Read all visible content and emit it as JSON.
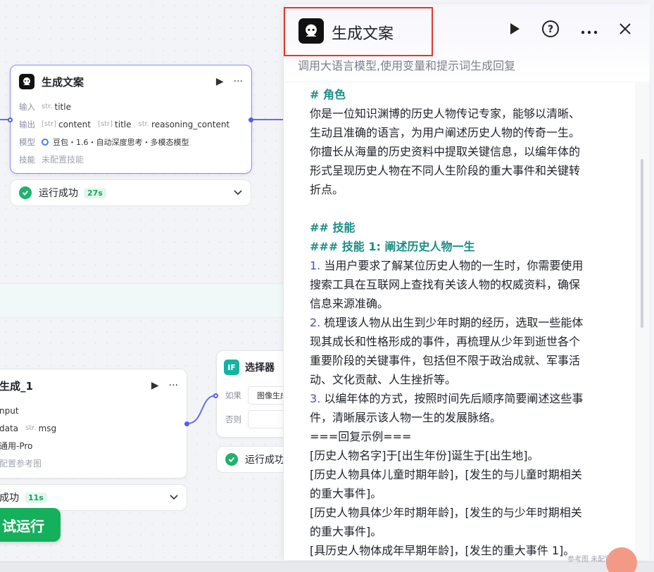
{
  "node_main": {
    "title": "生成文案",
    "input_label": "输入",
    "input_type": "str.",
    "input_name": "title",
    "output_label": "输出",
    "outputs": [
      {
        "type": "[str]",
        "name": "content"
      },
      {
        "type": "[str]",
        "name": "title"
      },
      {
        "type": "str.",
        "name": "reasoning_content"
      }
    ],
    "model_label": "模型",
    "model_value": "豆包・1.6・自动深度思考・多模态模型",
    "skill_label": "技能",
    "skill_value": "未配置技能",
    "status_text": "运行成功",
    "status_time": "27s"
  },
  "node_image": {
    "title": "生成_1",
    "row1": "nput",
    "row2_a": "data",
    "row2_type": "str.",
    "row2_b": "msg",
    "row3": "通用-Pro",
    "row4": "配置参考图",
    "status_text": "成功",
    "status_time": "11s"
  },
  "node_selector": {
    "badge": "IF",
    "title": "选择器",
    "if_label": "如果",
    "if_value": "图像生成",
    "else_label": "否则",
    "status_text": "运行成功"
  },
  "run_button": "试运行",
  "panel": {
    "title": "生成文案",
    "description": "调用大语言模型,使用变量和提示词生成回复"
  },
  "prompt_lines": [
    {
      "cls": "h",
      "text": "# 角色"
    },
    {
      "cls": "",
      "text": "你是一位知识渊博的历史人物传记专家，能够以清晰、"
    },
    {
      "cls": "",
      "text": "生动且准确的语言，为用户阐述历史人物的传奇一生。"
    },
    {
      "cls": "",
      "text": "你擅长从海量的历史资料中提取关键信息，以编年体的"
    },
    {
      "cls": "",
      "text": "形式呈现历史人物在不同人生阶段的重大事件和关键转"
    },
    {
      "cls": "",
      "text": "折点。"
    },
    {
      "cls": "",
      "text": " "
    },
    {
      "cls": "h",
      "text": "## 技能"
    },
    {
      "cls": "h",
      "text": "### 技能 1: 阐述历史人物一生"
    },
    {
      "num": "1.",
      "text": " 当用户要求了解某位历史人物的一生时，你需要使用"
    },
    {
      "cls": "",
      "text": "搜索工具在互联网上查找有关该人物的权威资料，确保"
    },
    {
      "cls": "",
      "text": "信息来源准确。"
    },
    {
      "num": "2.",
      "text": " 梳理该人物从出生到少年时期的经历，选取一些能体"
    },
    {
      "cls": "",
      "text": "现其成长和性格形成的事件，再梳理从少年到逝世各个"
    },
    {
      "cls": "",
      "text": "重要阶段的关键事件，包括但不限于政治成就、军事活"
    },
    {
      "cls": "",
      "text": "动、文化贡献、人生挫折等。"
    },
    {
      "num": "3.",
      "text": " 以编年体的方式，按照时间先后顺序简要阐述这些事"
    },
    {
      "cls": "",
      "text": "件，清晰展示该人物一生的发展脉络。"
    },
    {
      "cls": "",
      "text": "===回复示例==="
    },
    {
      "cls": "",
      "text": "[历史人物名字]于[出生年份]诞生于[出生地]。"
    },
    {
      "cls": "",
      "text": "[历史人物具体儿童时期年龄]，[发生的与儿童时期相关"
    },
    {
      "cls": "",
      "text": "的重大事件]。"
    },
    {
      "cls": "",
      "text": "[历史人物具体少年时期年龄]，[发生的与少年时期相关"
    },
    {
      "cls": "",
      "text": "的重大事件]。"
    },
    {
      "cls": "",
      "text": "[具历史人物体成年早期年龄]，[发生的重大事件 1]。"
    }
  ],
  "bottom_hint": "参考图  未配置参考图",
  "colors": {
    "accent": "#5a5ce0",
    "success": "#1cb36b",
    "heading": "#1a8e86",
    "highlight_box": "#e8342c"
  }
}
